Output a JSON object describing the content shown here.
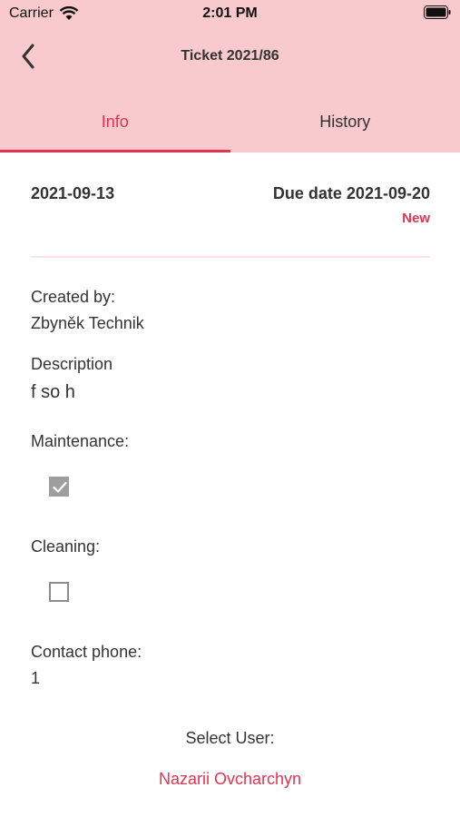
{
  "status_bar": {
    "carrier": "Carrier",
    "time": "2:01 PM"
  },
  "nav": {
    "title": "Ticket 2021/86"
  },
  "tabs": [
    {
      "label": "Info"
    },
    {
      "label": "History"
    }
  ],
  "ticket": {
    "date": "2021-09-13",
    "due_date": "Due date 2021-09-20",
    "status": "New"
  },
  "fields": {
    "created_by_label": "Created by:",
    "created_by_value": "Zbyněk Technik",
    "description_label": "Description",
    "description_value": "f so h",
    "maintenance_label": "Maintenance:",
    "maintenance_checked": true,
    "cleaning_label": "Cleaning:",
    "cleaning_checked": false,
    "contact_phone_label": "Contact phone:",
    "contact_phone_value": "1"
  },
  "select_user": {
    "label": "Select User:",
    "value": "Nazarii Ovcharchyn"
  },
  "colors": {
    "accent": "#e3334f",
    "header_bg": "#f8c9cd"
  }
}
